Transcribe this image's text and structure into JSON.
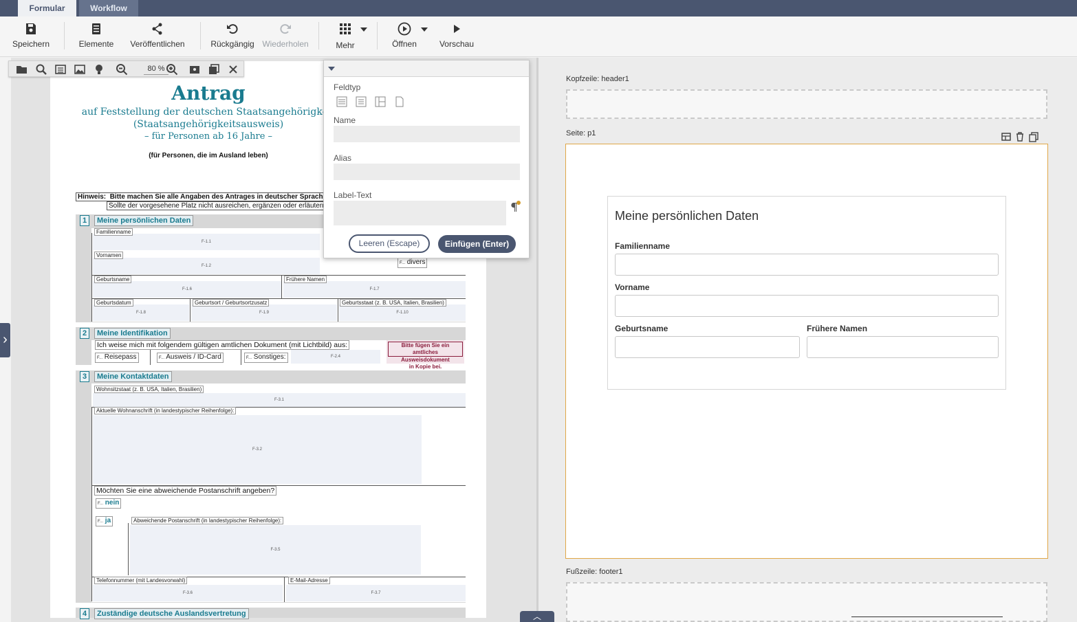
{
  "tabs": [
    {
      "label": "Formular"
    },
    {
      "label": "Workflow"
    }
  ],
  "toolbar": {
    "save": "Speichern",
    "elements": "Elemente",
    "publish": "Veröffentlichen",
    "undo": "Rückgängig",
    "redo": "Wiederholen",
    "more": "Mehr",
    "open": "Öffnen",
    "preview": "Vorschau"
  },
  "pdf_toolbar": {
    "zoom": "80 %"
  },
  "pdf": {
    "title": "Antrag",
    "subtitle1": "auf Feststellung der deutschen Staatsangehörigkeit",
    "subtitle2": "(Staatsangehörigkeitsausweis)",
    "subtitle3": "– für Personen ab 16 Jahre –",
    "subtitle4": "(für Personen, die im Ausland leben)",
    "hint_label": "Hinweis:",
    "hint_text1": "Bitte machen Sie alle Angaben des Antrages in deutscher Sprache.",
    "hint_text2": "Sollte der vorgesehene Platz nicht ausreichen, ergänzen oder erläutern S",
    "sections": [
      {
        "num": "1",
        "title": "Meine persönlichen Daten"
      },
      {
        "num": "2",
        "title": "Meine Identifikation"
      },
      {
        "num": "3",
        "title": "Meine Kontaktdaten"
      },
      {
        "num": "4",
        "title": "Zuständige deutsche Auslandsvertretung"
      }
    ],
    "s1": {
      "familienname": "Familienname",
      "f11": "F-1.1",
      "vornamen": "Vornamen",
      "f12": "F-1.2",
      "divers": "divers",
      "cb": "F...",
      "geburtsname": "Geburtsname",
      "f16": "F-1.6",
      "fruehere": "Frühere Namen",
      "f17": "F-1.7",
      "geburtsdatum": "Geburtsdatum",
      "f18": "F-1.8",
      "geburtsort": "Geburtsort / Geburtsortzusatz",
      "f19": "F-1.9",
      "geburtsstaat": "Geburtsstaat (z. B. USA, Italien, Brasilien)",
      "f110": "F-1.10"
    },
    "s2": {
      "dokument": "Ich weise mich mit folgendem gültigen amtlichen Dokument (mit Lichtbild) aus:",
      "cb": "F...",
      "reisepass": "Reisepass",
      "ausweis": "Ausweis / ID-Card",
      "sonstiges": "Sonstiges:",
      "f24": "F-2.4",
      "hinweis1": "Bitte fügen Sie ein amtliches",
      "hinweis2": "Ausweisdokument",
      "hinweis3": "in Kopie bei."
    },
    "s3": {
      "wohnsitzstaat": "Wohnsitzstaat (z. B. USA, Italien, Brasilien)",
      "f31": "F-3.1",
      "anschrift": "Aktuelle Wohnanschrift (in landestypischer Reihenfolge):",
      "f32": "F-3.2",
      "abweichend_frage": "Möchten Sie eine abweichende Postanschrift angeben?",
      "cb": "F...",
      "nein": "nein",
      "ja": "ja",
      "abweichend": "Abweichende Postanschrift (in landestypischer Reihenfolge):",
      "f35": "F-3.5",
      "telefon": "Telefonnummer (mit Landesvorwahl)",
      "f36": "F-3.6",
      "email": "E-Mail-Adresse",
      "f37": "F-3.7"
    }
  },
  "dialog": {
    "feldtyp": "Feldtyp",
    "name": "Name",
    "alias": "Alias",
    "labeltext": "Label-Text",
    "clear": "Leeren (Escape)",
    "insert": "Einfügen (Enter)"
  },
  "designer": {
    "header_label": "Kopfzeile: header1",
    "page_label": "Seite: p1",
    "footer_label": "Fußzeile: footer1",
    "card_title": "Meine persönlichen Daten",
    "familienname": "Familienname",
    "vorname": "Vorname",
    "geburtsname": "Geburtsname",
    "fruehere": "Frühere Namen"
  },
  "colors": {
    "brand": "#4a5670",
    "pdf_accent": "#1a7b8f",
    "page_border": "#e0a646"
  }
}
